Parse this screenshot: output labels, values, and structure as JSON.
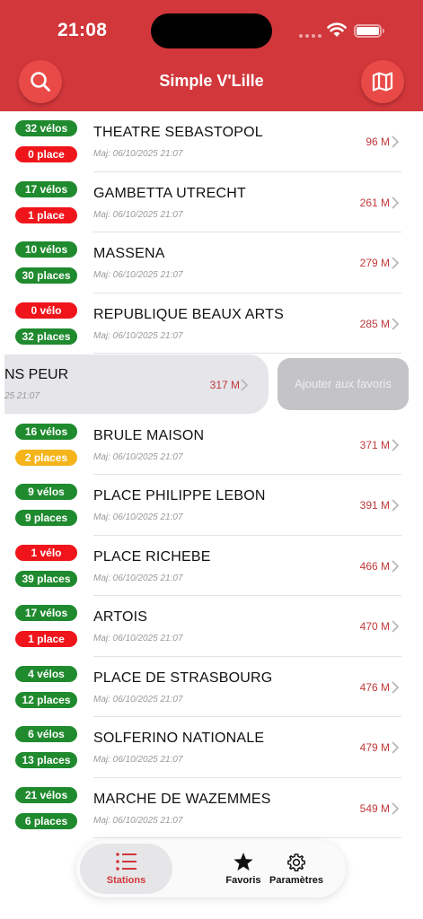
{
  "status_bar": {
    "time": "21:08"
  },
  "header": {
    "title": "Simple V'Lille"
  },
  "colors": {
    "brand": "#d2373b",
    "green": "#1f8a2e",
    "red": "#f0141b",
    "orange": "#f4b41a",
    "distance": "#c0393a"
  },
  "stations": [
    {
      "bikes": "32 vélos",
      "bikes_color": "green",
      "places": "0 place",
      "places_color": "red",
      "name": "THEATRE SEBASTOPOL",
      "updated": "Maj: 06/10/2025 21:07",
      "distance": "96 M"
    },
    {
      "bikes": "17 vélos",
      "bikes_color": "green",
      "places": "1 place",
      "places_color": "red",
      "name": "GAMBETTA UTRECHT",
      "updated": "Maj: 06/10/2025 21:07",
      "distance": "261 M"
    },
    {
      "bikes": "10 vélos",
      "bikes_color": "green",
      "places": "30 places",
      "places_color": "green",
      "name": "MASSENA",
      "updated": "Maj: 06/10/2025 21:07",
      "distance": "279 M"
    },
    {
      "bikes": "0 vélo",
      "bikes_color": "red",
      "places": "32 places",
      "places_color": "green",
      "name": "REPUBLIQUE BEAUX ARTS",
      "updated": "Maj: 06/10/2025 21:07",
      "distance": "285 M"
    },
    {
      "swiped": true,
      "name": "NS PEUR",
      "updated": "25 21:07",
      "distance": "317 M",
      "action": "Ajouter aux favoris"
    },
    {
      "bikes": "16 vélos",
      "bikes_color": "green",
      "places": "2 places",
      "places_color": "orange",
      "name": "BRULE MAISON",
      "updated": "Maj: 06/10/2025 21:07",
      "distance": "371 M"
    },
    {
      "bikes": "9 vélos",
      "bikes_color": "green",
      "places": "9 places",
      "places_color": "green",
      "name": "PLACE PHILIPPE LEBON",
      "updated": "Maj: 06/10/2025 21:07",
      "distance": "391 M"
    },
    {
      "bikes": "1 vélo",
      "bikes_color": "red",
      "places": "39 places",
      "places_color": "green",
      "name": "PLACE RICHEBE",
      "updated": "Maj: 06/10/2025 21:07",
      "distance": "466 M"
    },
    {
      "bikes": "17 vélos",
      "bikes_color": "green",
      "places": "1 place",
      "places_color": "red",
      "name": "ARTOIS",
      "updated": "Maj: 06/10/2025 21:07",
      "distance": "470 M"
    },
    {
      "bikes": "4 vélos",
      "bikes_color": "green",
      "places": "12 places",
      "places_color": "green",
      "name": "PLACE DE STRASBOURG",
      "updated": "Maj: 06/10/2025 21:07",
      "distance": "476 M"
    },
    {
      "bikes": "6 vélos",
      "bikes_color": "green",
      "places": "13 places",
      "places_color": "green",
      "name": "SOLFERINO NATIONALE",
      "updated": "Maj: 06/10/2025 21:07",
      "distance": "479 M"
    },
    {
      "bikes": "21 vélos",
      "bikes_color": "green",
      "places": "6 places",
      "places_color": "green",
      "name": "MARCHE DE WAZEMMES",
      "updated": "Maj: 06/10/2025 21:07",
      "distance": "549 M"
    }
  ],
  "tabbar": {
    "stations": "Stations",
    "favoris": "Favoris",
    "parametres": "Paramètres"
  }
}
